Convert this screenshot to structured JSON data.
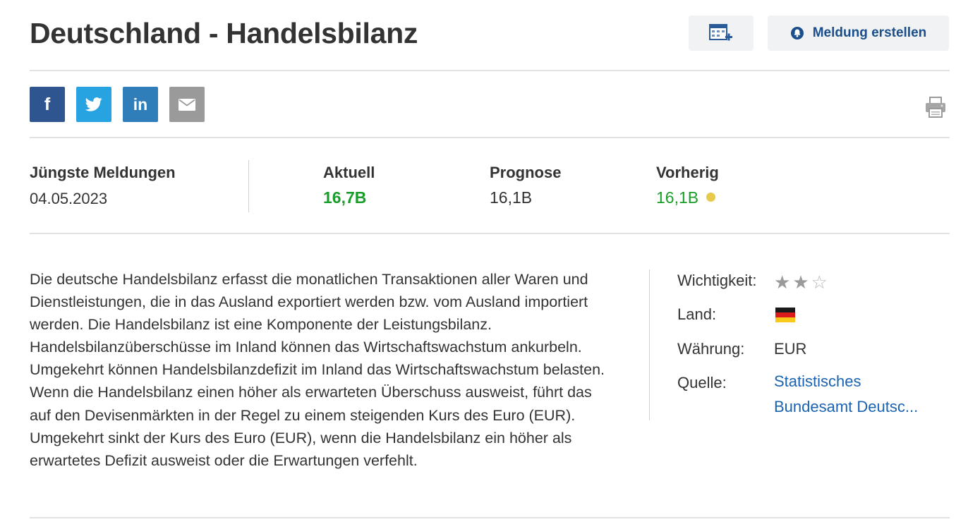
{
  "header": {
    "title": "Deutschland - Handelsbilanz",
    "calendar_icon": "calendar-add-icon",
    "alert_button_label": "Meldung erstellen",
    "alert_icon": "bell-icon"
  },
  "share": {
    "items": [
      {
        "name": "facebook",
        "icon": "facebook-icon",
        "glyph": "f",
        "color": "#2f5591"
      },
      {
        "name": "twitter",
        "icon": "twitter-icon",
        "color": "#26a3e0"
      },
      {
        "name": "linkedin",
        "icon": "linkedin-icon",
        "glyph": "in",
        "color": "#2f7db9"
      },
      {
        "name": "email",
        "icon": "email-icon",
        "color": "#9a9a9a"
      }
    ],
    "print_icon": "printer-icon"
  },
  "release": {
    "latest_label": "Jüngste Meldungen",
    "latest_date": "04.05.2023",
    "actual_label": "Aktuell",
    "actual_value": "16,7B",
    "forecast_label": "Prognose",
    "forecast_value": "16,1B",
    "previous_label": "Vorherig",
    "previous_value": "16,1B",
    "positive_color": "#1a9e2a",
    "revision_dot_color": "#e8c94e"
  },
  "description": "Die deutsche Handelsbilanz erfasst die monatlichen Transaktionen aller Waren und Dienstleistungen, die in das Ausland exportiert werden bzw. vom Ausland importiert werden. Die Handelsbilanz ist eine Komponente der Leistungsbilanz. Handelsbilanzüberschüsse im Inland können das Wirtschaftswachstum ankurbeln. Umgekehrt können Handelsbilanzdefizit im Inland das Wirtschaftswachstum belasten. Wenn die Handelsbilanz einen höher als erwarteten Überschuss ausweist, führt das auf den Devisenmärkten in der Regel zu einem steigenden Kurs des Euro (EUR). Umgekehrt sinkt der Kurs des Euro (EUR), wenn die Handelsbilanz ein höher als erwartetes Defizit ausweist oder die Erwartungen verfehlt.",
  "details": {
    "importance_label": "Wichtigkeit:",
    "importance_stars": 2,
    "importance_max": 3,
    "country_label": "Land:",
    "country_flag_icon": "germany-flag-icon",
    "currency_label": "Währung:",
    "currency_value": "EUR",
    "source_label": "Quelle:",
    "source_line1": "Statistisches",
    "source_line2": "Bundesamt Deutsc..."
  }
}
